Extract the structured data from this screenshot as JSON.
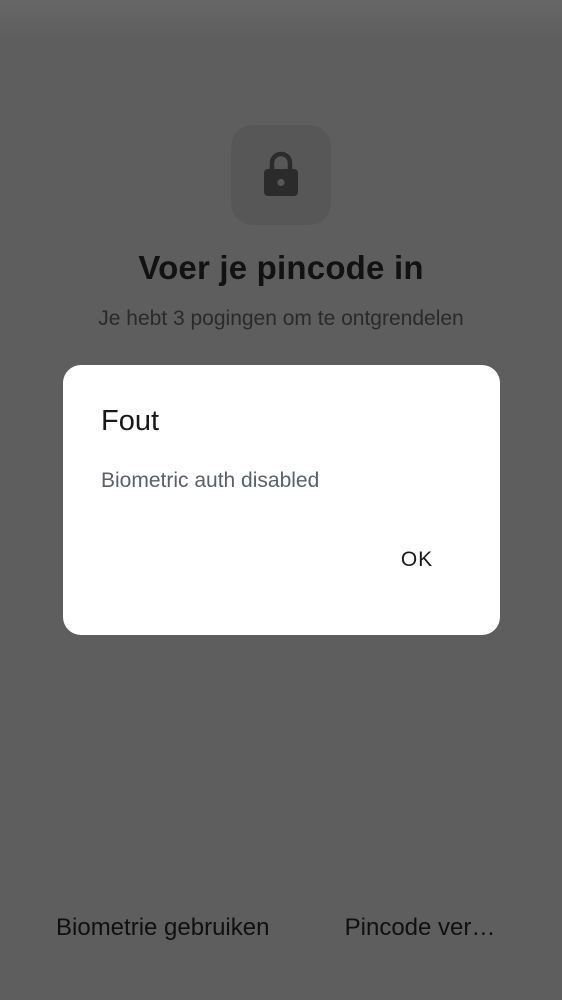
{
  "screen": {
    "title": "Voer je pincode in",
    "subtitle": "Je hebt 3 pogingen om te ontgrendelen",
    "lock_icon": "lock-icon"
  },
  "bottom_actions": {
    "biometrics_label": "Biometrie gebruiken",
    "pincode_label": "Pincode ver…"
  },
  "dialog": {
    "title": "Fout",
    "message": "Biometric auth disabled",
    "ok_label": "OK"
  },
  "colors": {
    "scrim_background": "#5e5e5e",
    "dialog_background": "#ffffff",
    "title_text": "#121212",
    "dialog_message_text": "#5b6066"
  }
}
